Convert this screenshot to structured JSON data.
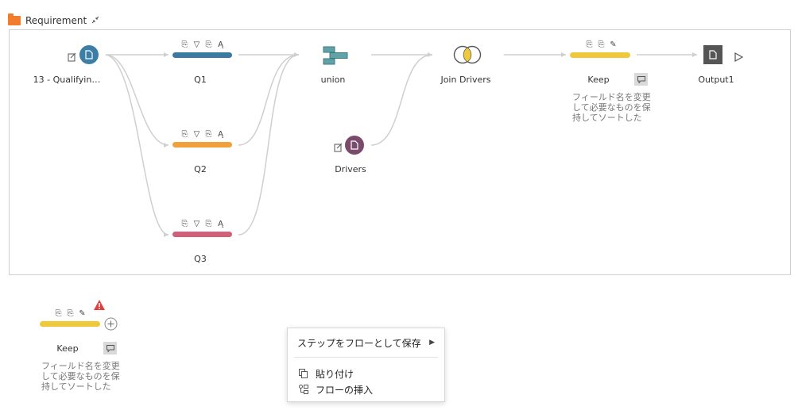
{
  "group": {
    "title": "Requirement"
  },
  "nodes": {
    "input": {
      "label": "13 - Qualifyin…"
    },
    "q1": {
      "label": "Q1"
    },
    "q2": {
      "label": "Q2"
    },
    "q3": {
      "label": "Q3"
    },
    "union": {
      "label": "union"
    },
    "drivers": {
      "label": "Drivers"
    },
    "join": {
      "label": "Join Drivers"
    },
    "keep": {
      "label": "Keep",
      "description": [
        "フィールド名を変更",
        "して必要なものを保",
        "持してソートした"
      ]
    },
    "output": {
      "label": "Output1"
    }
  },
  "loose_step": {
    "label": "Keep",
    "description": [
      "フィールド名を変更",
      "して必要なものを保",
      "持してソートした"
    ]
  },
  "context_menu": {
    "save_as_flow": "ステップをフローとして保存",
    "paste": "貼り付け",
    "insert_flow": "フローの挿入"
  },
  "colors": {
    "q1": "#3b7aa0",
    "q2": "#f0a03c",
    "q3": "#d0607a",
    "keep": "#f0c93b",
    "input": "#3d7ea6",
    "drivers": "#7b4b6d",
    "union": "#5fa3a8",
    "link": "#cccccc"
  },
  "icons": [
    "folder-icon",
    "collapse-icon",
    "document-icon",
    "filter-icon",
    "rename-icon",
    "union-icon",
    "join-icon",
    "output-icon",
    "run-icon",
    "comment-icon",
    "warning-icon",
    "add-icon",
    "chevron-right-icon",
    "paste-icon",
    "insert-flow-icon"
  ]
}
